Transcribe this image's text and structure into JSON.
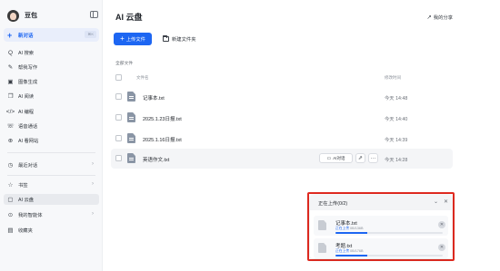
{
  "sidebar": {
    "app_name": "豆包",
    "new_chat": {
      "label": "新对话",
      "shortcut": "⌘K"
    },
    "items": [
      {
        "icon": "ai-search-icon",
        "label": "AI 搜索"
      },
      {
        "icon": "pen-icon",
        "label": "帮我写作"
      },
      {
        "icon": "image-icon",
        "label": "图像生成"
      },
      {
        "icon": "book-icon",
        "label": "AI 阅读"
      },
      {
        "icon": "code-icon",
        "label": "AI 编程"
      },
      {
        "icon": "phone-icon",
        "label": "语音通话"
      },
      {
        "icon": "browser-icon",
        "label": "AI 看网站"
      }
    ],
    "recent_chats_label": "最近对话",
    "bottom_items": [
      {
        "icon": "star-icon",
        "label": "书签"
      },
      {
        "icon": "cloud-drive-icon",
        "label": "AI 云盘"
      },
      {
        "icon": "agent-icon",
        "label": "我的智能体"
      },
      {
        "icon": "bookmark-icon",
        "label": "收藏夹"
      }
    ]
  },
  "main": {
    "title": "AI 云盘",
    "my_share": "我的分享",
    "upload_button": "上传文件",
    "new_folder_button": "新建文件夹",
    "section_label": "全部文件",
    "columns": {
      "name": "文件名",
      "time": "修改时间"
    },
    "files": [
      {
        "name": "记事本.txt",
        "time": "今天 14:48"
      },
      {
        "name": "2025.1.23日报.txt",
        "time": "今天 14:40"
      },
      {
        "name": "2025.1.16日报.txt",
        "time": "今天 14:39"
      },
      {
        "name": "英语作文.txt",
        "time": "今天 14:28"
      }
    ],
    "hover_actions": {
      "chat": "AI对话"
    }
  },
  "upload_panel": {
    "title": "正在上传(0/2)",
    "items": [
      {
        "name": "记事本.txt",
        "status": "正在上传",
        "size": "0B/136B"
      },
      {
        "name": "考题.txt",
        "status": "正在上传",
        "size": "0B/176B"
      }
    ]
  },
  "colors": {
    "accent": "#1d66f2",
    "highlight_outline": "#e02a20"
  }
}
